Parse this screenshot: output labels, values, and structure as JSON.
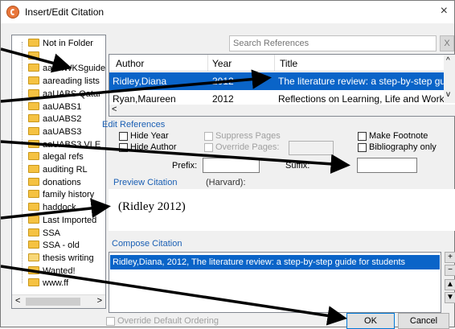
{
  "window": {
    "title": "Insert/Edit Citation",
    "close": "×"
  },
  "folders": [
    {
      "label": "Not in Folder"
    },
    {
      "label": ""
    },
    {
      "label": "aaaRWKSguide"
    },
    {
      "label": "aareading lists"
    },
    {
      "label": "aaUABS Qatar"
    },
    {
      "label": "aaUABS1"
    },
    {
      "label": "aaUABS2"
    },
    {
      "label": "aaUABS3"
    },
    {
      "label": "aaUABS3 VLE"
    },
    {
      "label": "alegal refs"
    },
    {
      "label": "auditing RL"
    },
    {
      "label": "donations"
    },
    {
      "label": "family history"
    },
    {
      "label": "haddock"
    },
    {
      "label": "Last Imported"
    },
    {
      "label": "SSA"
    },
    {
      "label": "SSA - old"
    },
    {
      "label": "thesis writing"
    },
    {
      "label": "Wanted!"
    },
    {
      "label": "www.ff"
    }
  ],
  "search": {
    "placeholder": "Search References",
    "clear": "X"
  },
  "grid": {
    "headers": {
      "author": "Author",
      "year": "Year",
      "title": "Title"
    },
    "rows": [
      {
        "author": "Ridley,Diana",
        "year": "2012",
        "title": "The literature review: a step-by-step guide fo"
      },
      {
        "author": "Ryan,Maureen",
        "year": "2012",
        "title": "Reflections on Learning, Life and Work : Com"
      }
    ]
  },
  "edit": {
    "section": "Edit References",
    "hide_year": "Hide Year",
    "hide_author": "Hide Author",
    "suppress_pages": "Suppress Pages",
    "override_pages": "Override Pages:",
    "make_footnote": "Make Footnote",
    "bibliography_only": "Bibliography only",
    "prefix": "Prefix:",
    "suffix": "Suffix:"
  },
  "preview": {
    "label": "Preview Citation",
    "style": "(Harvard):",
    "text": "(Ridley 2012)"
  },
  "compose": {
    "label": "Compose Citation",
    "item": "Ridley,Diana, 2012, The literature review: a step-by-step guide for students",
    "buttons": [
      "+",
      "−",
      "▲",
      "▼"
    ]
  },
  "footer": {
    "override": "Override Default Ordering",
    "ok": "OK",
    "cancel": "Cancel"
  },
  "colors": {
    "selection": "#0a64c8",
    "section_label": "#1a5fb4",
    "arrow": "#000000"
  }
}
